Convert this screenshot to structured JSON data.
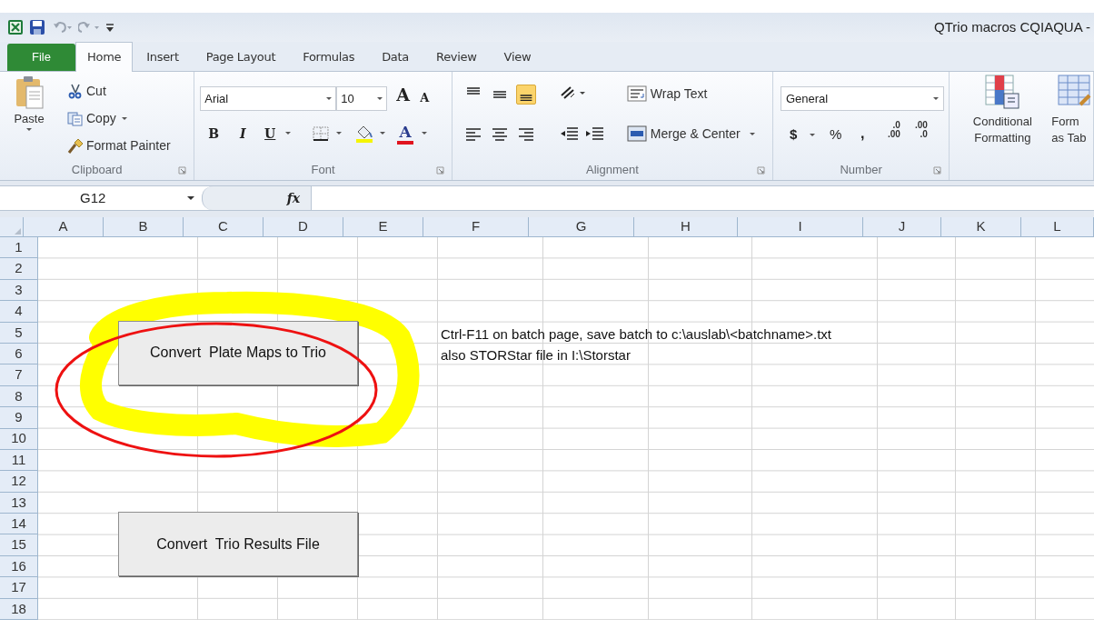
{
  "window": {
    "title": "QTrio macros CQIAQUA  -"
  },
  "tabs": [
    {
      "label": "File",
      "kind": "file",
      "selected": false
    },
    {
      "label": "Home",
      "kind": "tab",
      "selected": true
    },
    {
      "label": "Insert",
      "kind": "tab",
      "selected": false
    },
    {
      "label": "Page Layout",
      "kind": "tab",
      "selected": false
    },
    {
      "label": "Formulas",
      "kind": "tab",
      "selected": false
    },
    {
      "label": "Data",
      "kind": "tab",
      "selected": false
    },
    {
      "label": "Review",
      "kind": "tab",
      "selected": false
    },
    {
      "label": "View",
      "kind": "tab",
      "selected": false
    }
  ],
  "ribbon": {
    "clipboard": {
      "paste": "Paste",
      "cut": "Cut",
      "copy": "Copy",
      "format_painter": "Format Painter",
      "label": "Clipboard"
    },
    "font": {
      "name": "Arial",
      "size": "10",
      "grow": "A",
      "shrink": "A",
      "bold": "B",
      "italic": "I",
      "underline": "U",
      "font_color_letter": "A",
      "label": "Font"
    },
    "alignment": {
      "vertical": [
        {
          "selected": false
        },
        {
          "selected": false
        },
        {
          "selected": true
        }
      ],
      "wrap_text": "Wrap Text",
      "merge_center": "Merge & Center",
      "label": "Alignment"
    },
    "number": {
      "format": "General",
      "currency": "$",
      "percent": "%",
      "comma": ",",
      "increase_decimal": [
        ".0",
        ".00"
      ],
      "decrease_decimal": [
        ".00",
        ".0"
      ],
      "label": "Number"
    },
    "styles": {
      "conditional_formatting": [
        "Conditional",
        "Formatting"
      ],
      "format_as_table": [
        "Form",
        "as Tab"
      ]
    }
  },
  "formula_bar": {
    "name_box": "G12",
    "function_label": "fx"
  },
  "sheet": {
    "columns": [
      "A",
      "B",
      "C",
      "D",
      "E",
      "F",
      "G",
      "H",
      "I",
      "J",
      "K",
      "L"
    ],
    "rows": [
      "1",
      "2",
      "3",
      "4",
      "5",
      "6",
      "7",
      "8",
      "9",
      "10",
      "11",
      "12",
      "13",
      "14",
      "15",
      "16",
      "17",
      "18"
    ],
    "notes": [
      "Ctrl-F11 on batch page, save batch to c:\\auslab\\<batchname>.txt",
      "also STORStar file in I:\\Storstar"
    ],
    "buttons": [
      "Convert  Plate Maps to Trio",
      "Convert  Trio Results File"
    ]
  }
}
